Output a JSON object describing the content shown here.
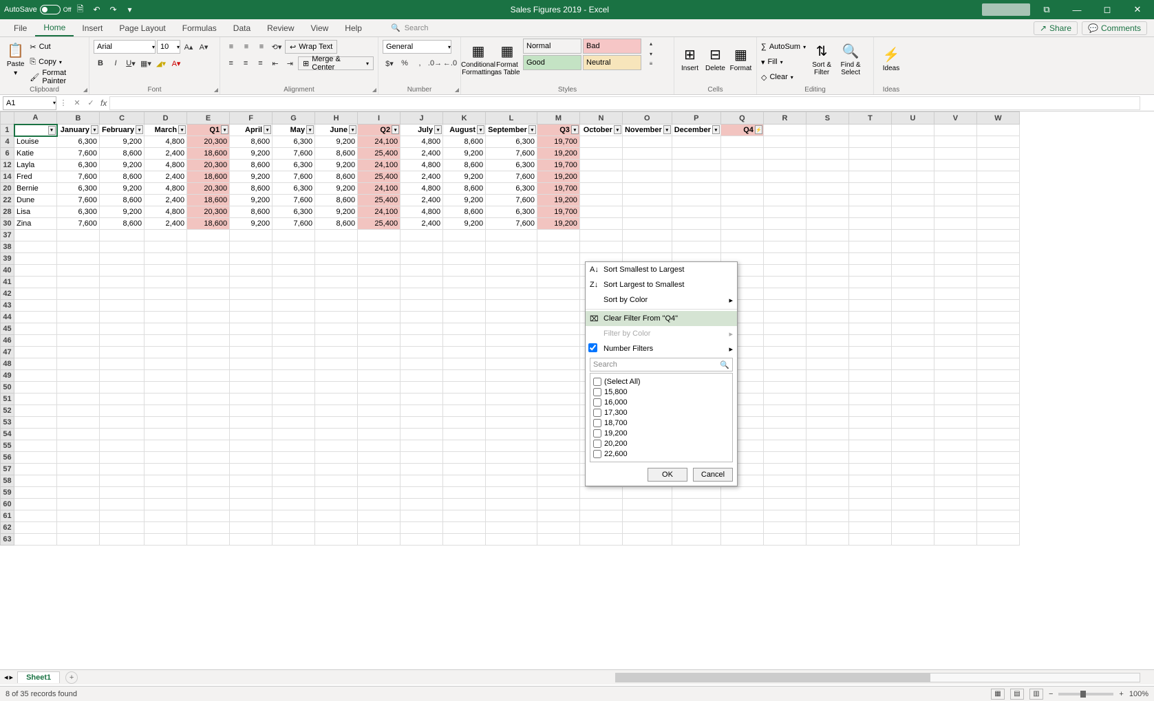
{
  "title": "Sales Figures 2019  -  Excel",
  "autosave": {
    "label": "AutoSave",
    "value": "Off"
  },
  "tabs": [
    "File",
    "Home",
    "Insert",
    "Page Layout",
    "Formulas",
    "Data",
    "Review",
    "View",
    "Help"
  ],
  "active_tab": "Home",
  "search_placeholder": "Search",
  "share": "Share",
  "comments": "Comments",
  "clipboard": {
    "paste": "Paste",
    "cut": "Cut",
    "copy": "Copy",
    "painter": "Format Painter",
    "label": "Clipboard"
  },
  "font": {
    "name": "Arial",
    "size": "10",
    "label": "Font"
  },
  "align": {
    "wrap": "Wrap Text",
    "merge": "Merge & Center",
    "label": "Alignment"
  },
  "number": {
    "fmt": "General",
    "label": "Number"
  },
  "styles": {
    "cond": "Conditional Formatting",
    "table": "Format as Table",
    "normal": "Normal",
    "bad": "Bad",
    "good": "Good",
    "neutral": "Neutral",
    "label": "Styles"
  },
  "cells": {
    "insert": "Insert",
    "delete": "Delete",
    "format": "Format",
    "label": "Cells"
  },
  "editing": {
    "sum": "AutoSum",
    "fill": "Fill",
    "clear": "Clear",
    "sort": "Sort & Filter",
    "find": "Find & Select",
    "label": "Editing"
  },
  "ideas": {
    "label": "Ideas",
    "btn": "Ideas"
  },
  "namebox": "A1",
  "columns": [
    "A",
    "B",
    "C",
    "D",
    "E",
    "F",
    "G",
    "H",
    "I",
    "J",
    "K",
    "L",
    "M",
    "N",
    "O",
    "P",
    "Q",
    "R",
    "S",
    "T",
    "U",
    "V",
    "W"
  ],
  "headers": [
    "",
    "January",
    "February",
    "March",
    "Q1",
    "April",
    "May",
    "June",
    "Q2",
    "July",
    "August",
    "September",
    "Q3",
    "October",
    "November",
    "December",
    "Q4"
  ],
  "qcols": [
    4,
    8,
    12,
    16
  ],
  "rows": [
    {
      "n": 4,
      "d": [
        "Louise",
        "6,300",
        "9,200",
        "4,800",
        "20,300",
        "8,600",
        "6,300",
        "9,200",
        "24,100",
        "4,800",
        "8,600",
        "6,300",
        "19,700"
      ]
    },
    {
      "n": 6,
      "d": [
        "Katie",
        "7,600",
        "8,600",
        "2,400",
        "18,600",
        "9,200",
        "7,600",
        "8,600",
        "25,400",
        "2,400",
        "9,200",
        "7,600",
        "19,200"
      ]
    },
    {
      "n": 12,
      "d": [
        "Layla",
        "6,300",
        "9,200",
        "4,800",
        "20,300",
        "8,600",
        "6,300",
        "9,200",
        "24,100",
        "4,800",
        "8,600",
        "6,300",
        "19,700"
      ]
    },
    {
      "n": 14,
      "d": [
        "Fred",
        "7,600",
        "8,600",
        "2,400",
        "18,600",
        "9,200",
        "7,600",
        "8,600",
        "25,400",
        "2,400",
        "9,200",
        "7,600",
        "19,200"
      ]
    },
    {
      "n": 20,
      "d": [
        "Bernie",
        "6,300",
        "9,200",
        "4,800",
        "20,300",
        "8,600",
        "6,300",
        "9,200",
        "24,100",
        "4,800",
        "8,600",
        "6,300",
        "19,700"
      ]
    },
    {
      "n": 22,
      "d": [
        "Dune",
        "7,600",
        "8,600",
        "2,400",
        "18,600",
        "9,200",
        "7,600",
        "8,600",
        "25,400",
        "2,400",
        "9,200",
        "7,600",
        "19,200"
      ]
    },
    {
      "n": 28,
      "d": [
        "Lisa",
        "6,300",
        "9,200",
        "4,800",
        "20,300",
        "8,600",
        "6,300",
        "9,200",
        "24,100",
        "4,800",
        "8,600",
        "6,300",
        "19,700"
      ]
    },
    {
      "n": 30,
      "d": [
        "Zina",
        "7,600",
        "8,600",
        "2,400",
        "18,600",
        "9,200",
        "7,600",
        "8,600",
        "25,400",
        "2,400",
        "9,200",
        "7,600",
        "19,200"
      ]
    }
  ],
  "empty_rows": [
    37,
    38,
    39,
    40,
    41,
    42,
    43,
    44,
    45,
    46,
    47,
    48,
    49,
    50,
    51,
    52,
    53,
    54,
    55,
    56,
    57,
    58,
    59,
    60,
    61,
    62,
    63
  ],
  "filter": {
    "sort_asc": "Sort Smallest to Largest",
    "sort_desc": "Sort Largest to Smallest",
    "sort_color": "Sort by Color",
    "clear": "Clear Filter From \"Q4\"",
    "filter_color": "Filter by Color",
    "number_filters": "Number Filters",
    "search": "Search",
    "selectall": "(Select All)",
    "options": [
      "15,800",
      "16,000",
      "17,300",
      "18,700",
      "19,200",
      "20,200",
      "22,600"
    ],
    "ok": "OK",
    "cancel": "Cancel"
  },
  "sheet": "Sheet1",
  "status": "8 of 35 records found",
  "zoom": "100%"
}
